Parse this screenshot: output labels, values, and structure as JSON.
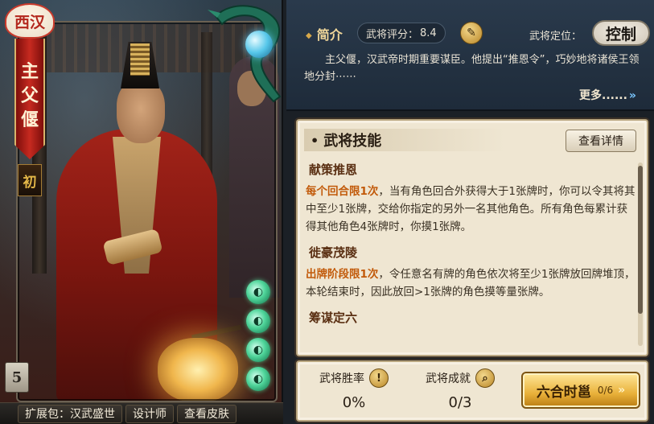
{
  "character": {
    "dynasty": "西汉",
    "name_chars": [
      "主",
      "父",
      "偃"
    ],
    "rank": "初",
    "level": "5",
    "skill_orb_count": 4
  },
  "bottom_tabs": {
    "pack": "扩展包：汉武盛世",
    "designer": "设计师",
    "skins": "查看皮肤"
  },
  "intro": {
    "title": "简介",
    "score_label": "武将评分：",
    "score_value": "8.4",
    "role_label": "武将定位：",
    "role_value": "控制",
    "text": "主父偃，汉武帝时期重要谋臣。他提出“推恩令”，巧妙地将诸侯王领地分封⋯⋯",
    "more": "更多......"
  },
  "skills": {
    "header": "武将技能",
    "detail_button": "查看详情",
    "items": [
      {
        "name": "献策推恩",
        "highlight": "每个回合限1次",
        "desc": "，当有角色回合外获得大于1张牌时，你可以令其将其中至少1张牌，交给你指定的另外一名其他角色。所有角色每累计获得其他角色4张牌时，你摸1张牌。"
      },
      {
        "name": "徙豪茂陵",
        "highlight": "出牌阶段限1次",
        "desc": "，令任意名有牌的角色依次将至少1张牌放回牌堆顶，本轮结束时，因此放回>1张牌的角色摸等量张牌。"
      },
      {
        "name": "筹谋定六",
        "highlight": "",
        "desc": ""
      }
    ]
  },
  "stats": {
    "win_rate_label": "武将胜率",
    "win_rate_value": "0%",
    "achievement_label": "武将成就",
    "achievement_value": "0/3",
    "combo_label": "六合时邕",
    "combo_progress": "0/6"
  },
  "colors": {
    "highlight": "#c25a0a",
    "banner_red": "#c62a20",
    "orb_green": "#4fd59a",
    "gold": "#e9b13a"
  }
}
